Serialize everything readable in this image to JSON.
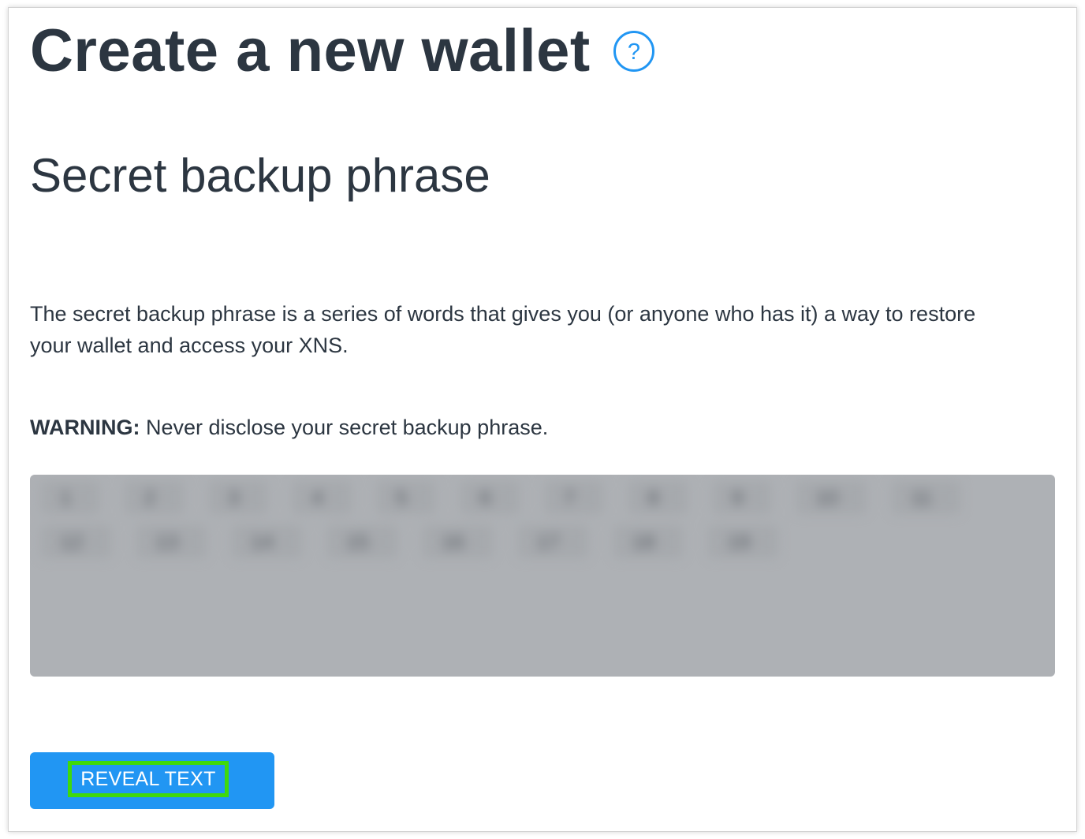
{
  "header": {
    "title": "Create a new wallet",
    "help_icon": "question-circle-icon"
  },
  "section": {
    "title": "Secret backup phrase",
    "description": "The secret backup phrase is a series of words that gives you (or anyone who has it) a way to restore your wallet and access your XNS.",
    "warning_label": "WARNING:",
    "warning_text": " Never disclose your secret backup phrase."
  },
  "phrase": {
    "blurred": true,
    "words": [
      {
        "num": "1",
        "word": ""
      },
      {
        "num": "2",
        "word": ""
      },
      {
        "num": "3",
        "word": ""
      },
      {
        "num": "4",
        "word": ""
      },
      {
        "num": "5",
        "word": ""
      },
      {
        "num": "6",
        "word": ""
      },
      {
        "num": "7",
        "word": ""
      },
      {
        "num": "8",
        "word": ""
      },
      {
        "num": "9",
        "word": ""
      },
      {
        "num": "10",
        "word": ""
      },
      {
        "num": "11",
        "word": ""
      },
      {
        "num": "12",
        "word": ""
      },
      {
        "num": "13",
        "word": ""
      },
      {
        "num": "14",
        "word": ""
      },
      {
        "num": "15",
        "word": ""
      },
      {
        "num": "16",
        "word": ""
      },
      {
        "num": "17",
        "word": ""
      },
      {
        "num": "18",
        "word": ""
      },
      {
        "num": "19",
        "word": ""
      }
    ]
  },
  "actions": {
    "reveal_label": "REVEAL TEXT"
  },
  "colors": {
    "primary": "#2196f3",
    "highlight": "#3fd90a",
    "text": "#2c3641",
    "phrase_bg": "#aeb1b5"
  }
}
